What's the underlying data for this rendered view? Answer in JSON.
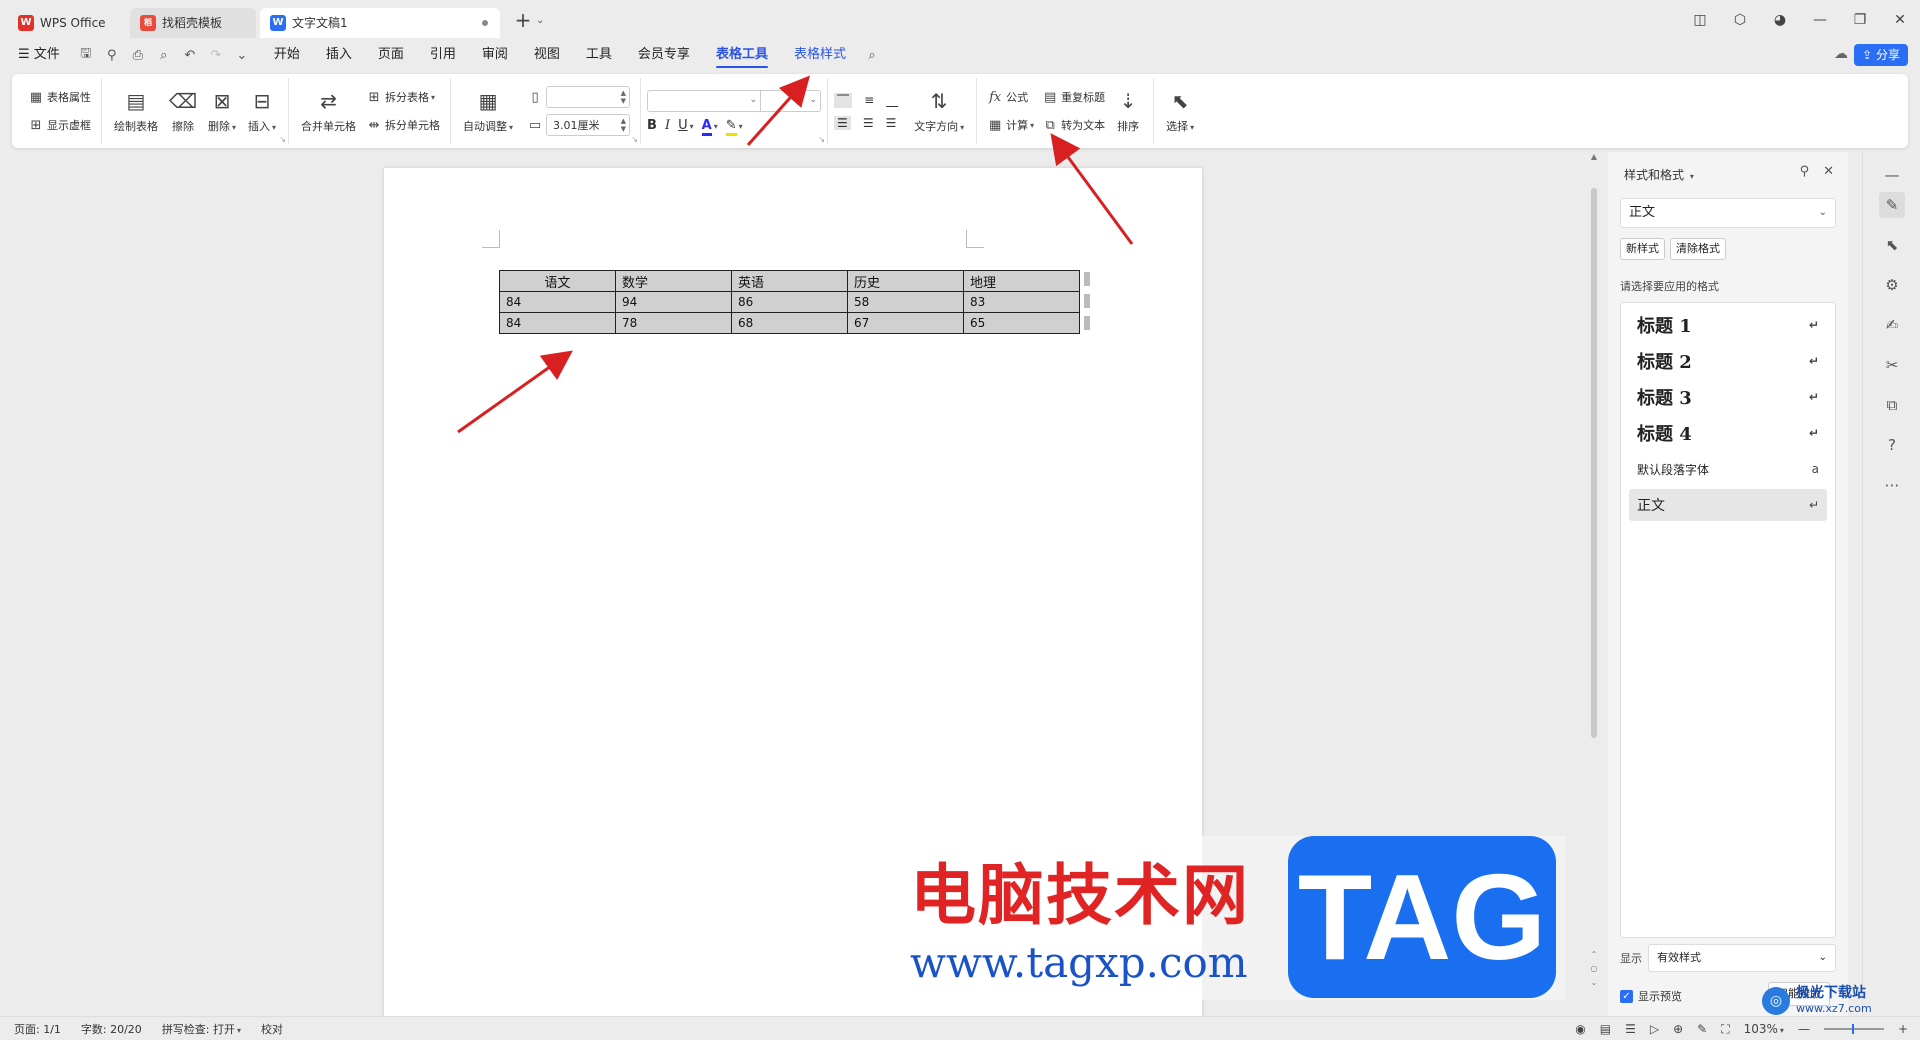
{
  "tabs": [
    {
      "label": "WPS Office",
      "logo": "W"
    },
    {
      "label": "找稻壳模板",
      "logo": "稻"
    },
    {
      "label": "文字文稿1",
      "logo": "W"
    }
  ],
  "menu": {
    "file": "文件",
    "items": [
      "开始",
      "插入",
      "页面",
      "引用",
      "审阅",
      "视图",
      "工具",
      "会员专享",
      "表格工具",
      "表格样式"
    ],
    "active": "表格工具",
    "share": "分享"
  },
  "ribbon": {
    "table_props": "表格属性",
    "show_gridlines": "显示虚框",
    "draw_table": "绘制表格",
    "erase": "擦除",
    "delete": "删除",
    "insert": "插入",
    "merge_cells": "合并单元格",
    "split_table": "拆分表格",
    "split_cells": "拆分单元格",
    "auto_fit": "自动调整",
    "width_value": "3.01厘米",
    "text_direction": "文字方向",
    "formula": "公式",
    "calculate": "计算",
    "repeat_header": "重复标题",
    "to_text": "转为文本",
    "sort": "排序",
    "select": "选择",
    "bold": "B",
    "italic": "I",
    "underline": "U",
    "font_color": "A"
  },
  "table": {
    "rows": [
      [
        "语文",
        "数学",
        "英语",
        "历史",
        "地理"
      ],
      [
        "84",
        "94",
        "86",
        "58",
        "83"
      ],
      [
        "84",
        "78",
        "68",
        "67",
        "65"
      ]
    ]
  },
  "panel": {
    "title": "样式和格式",
    "current_style": "正文",
    "new_style": "新样式",
    "clear_format": "清除格式",
    "prompt": "请选择要应用的格式",
    "styles": [
      "标题  1",
      "标题  2",
      "标题  3",
      "标题 4",
      "默认段落字体",
      "正文"
    ],
    "show_label": "显示",
    "show_value": "有效样式",
    "preview": "显示预览",
    "smart": "智能排版"
  },
  "status": {
    "page": "页面: 1/1",
    "words": "字数: 20/20",
    "spell": "拼写检查: 打开",
    "proof": "校对",
    "zoom": "103%"
  },
  "watermark": {
    "cn": "电脑技术网",
    "url": "www.tagxp.com",
    "tag": "TAG",
    "corner_title": "极光下载站",
    "corner_sub": "www.xz7.com"
  },
  "colors": {
    "accent": "#2a55e5",
    "arrow": "#d92020",
    "table_fill": "#d0d0d0"
  }
}
